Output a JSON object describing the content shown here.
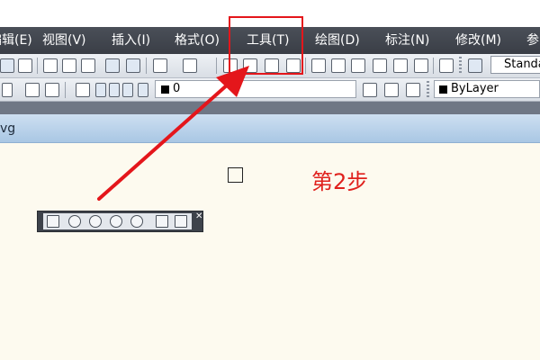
{
  "menu": {
    "items": [
      {
        "label": "编辑(E)"
      },
      {
        "label": "视图(V)"
      },
      {
        "label": "插入(I)"
      },
      {
        "label": "格式(O)"
      },
      {
        "label": "工具(T)"
      },
      {
        "label": "绘图(D)"
      },
      {
        "label": "标注(N)"
      },
      {
        "label": "修改(M)"
      },
      {
        "label": "参"
      }
    ]
  },
  "toolbar": {
    "text_style_value": "Standard",
    "layer_value": "0",
    "color_value": "ByLayer"
  },
  "drawing_tab": {
    "label": "vg"
  },
  "annotation": {
    "step_text": "第2步"
  },
  "colors": {
    "menu_bg": "#3f444c",
    "highlight": "#e4161b",
    "canvas_bg": "#fdfaef",
    "tab_strip": "#bcd4ec"
  }
}
